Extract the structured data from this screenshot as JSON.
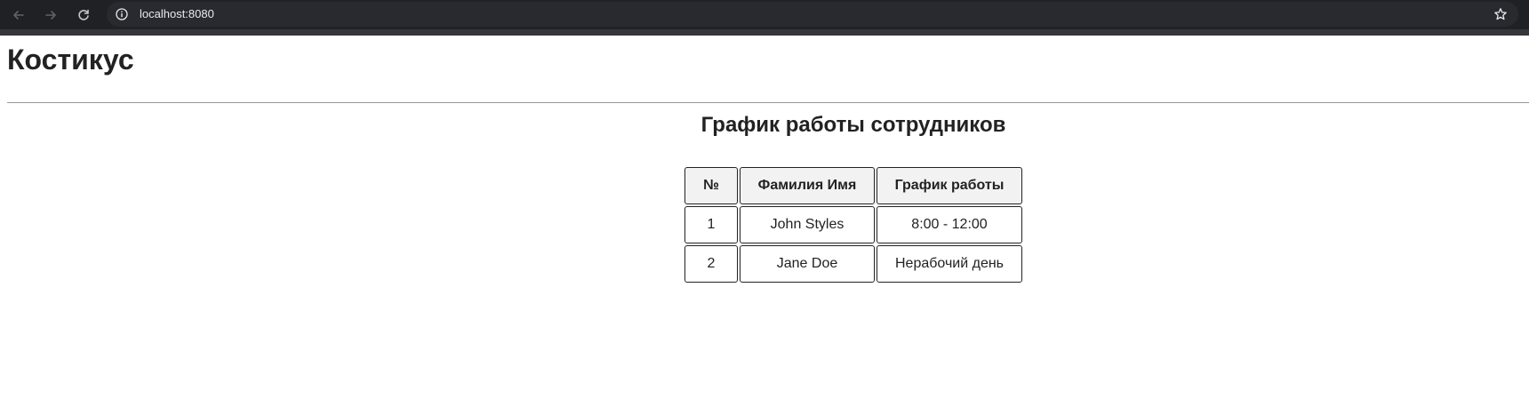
{
  "browser": {
    "url": "localhost:8080",
    "icons": {
      "back": "arrow-left-icon",
      "forward": "arrow-right-icon",
      "reload": "reload-icon",
      "site_info": "info-icon",
      "bookmark": "star-icon"
    }
  },
  "header": {
    "title": "Костикус"
  },
  "main": {
    "heading": "График работы сотрудников",
    "table": {
      "columns": [
        "№",
        "Фамилия Имя",
        "График работы"
      ],
      "rows": [
        [
          "1",
          "John Styles",
          "8:00 - 12:00"
        ],
        [
          "2",
          "Jane Doe",
          "Нерабочий день"
        ]
      ]
    }
  },
  "colors": {
    "chrome_background": "#202124",
    "omnibox_background": "#282a2f",
    "text": "#222222",
    "header_cell_background": "#f2f2f2",
    "cell_border": "#222222"
  }
}
